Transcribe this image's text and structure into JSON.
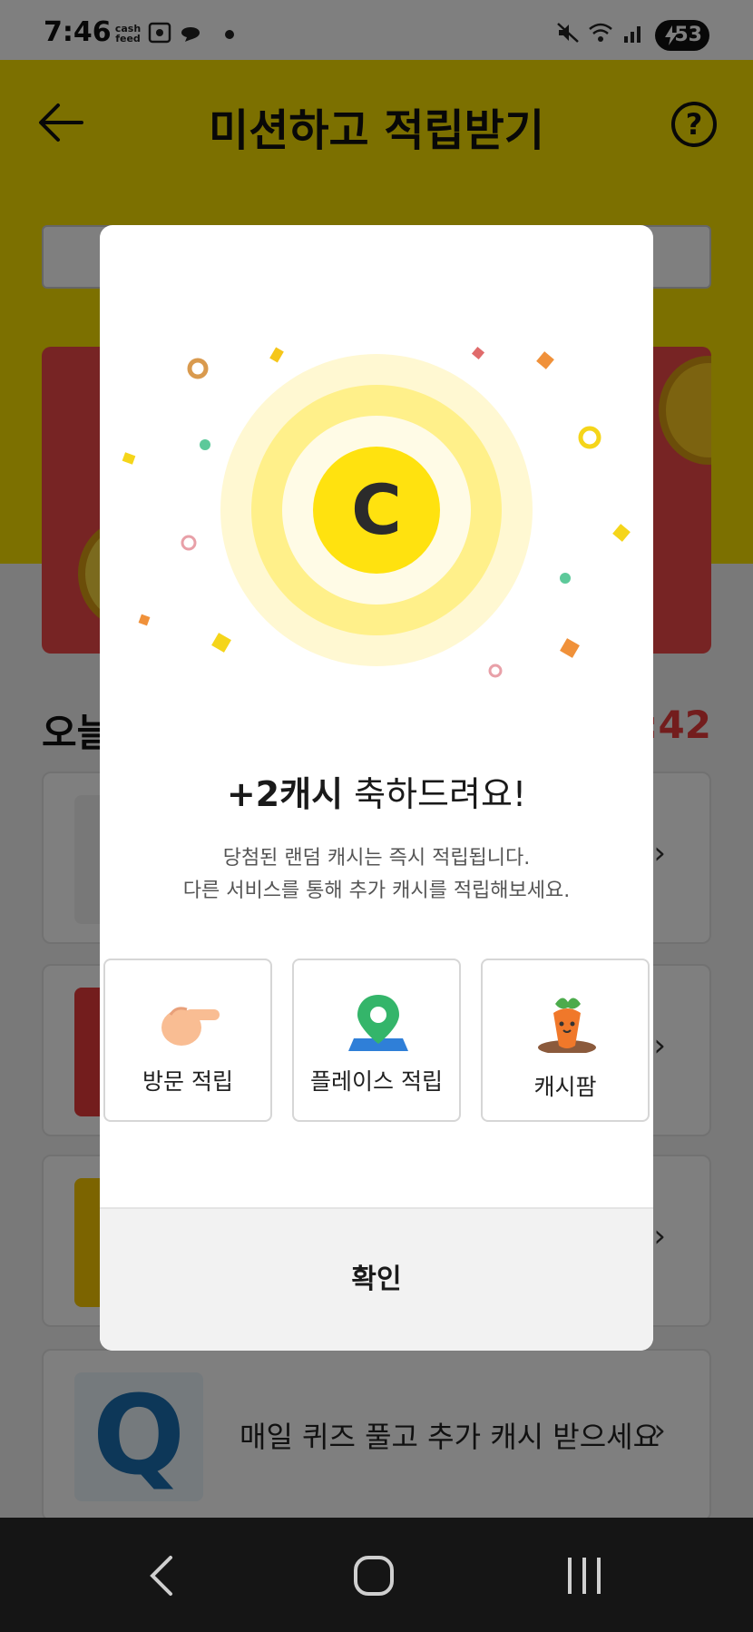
{
  "status_bar": {
    "time": "7:46",
    "cash_feed_label": "cash feed",
    "battery_level": "53"
  },
  "header": {
    "title": "미션하고 적립받기",
    "help_label": "?"
  },
  "background": {
    "section_title": "오늘",
    "timer_text": ":42",
    "last_mission_text": "매일 퀴즈 풀고 추가 캐시 받으세요",
    "last_mission_thumb": "Q",
    "chevron": "›"
  },
  "modal": {
    "reward_amount": "+2캐시",
    "reward_suffix": " 축하드려요!",
    "desc_line1": "당첨된 랜덤 캐시는 즉시 적립됩니다.",
    "desc_line2": "다른 서비스를 통해 추가 캐시를 적립해보세요.",
    "coin_letter": "C",
    "services": [
      {
        "label": "방문 적립",
        "icon": "pointing-hand-icon"
      },
      {
        "label": "플레이스 적립",
        "icon": "map-pin-icon"
      },
      {
        "label": "캐시팜",
        "icon": "carrot-icon"
      }
    ],
    "confirm_label": "확인"
  },
  "colors": {
    "brand_yellow": "#f9e000",
    "coin_yellow": "#ffe20f",
    "timer_red": "#e63b3b"
  }
}
